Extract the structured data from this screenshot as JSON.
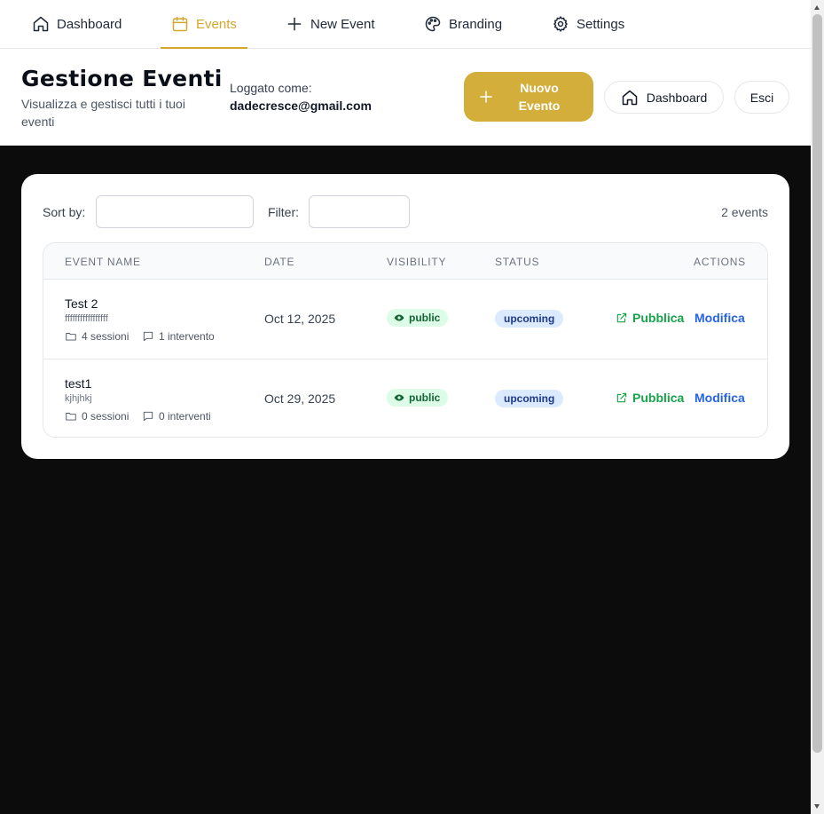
{
  "nav": {
    "items": [
      {
        "label": "Dashboard",
        "icon": "home-icon"
      },
      {
        "label": "Events",
        "icon": "calendar-icon",
        "active": true
      },
      {
        "label": "New Event",
        "icon": "plus-icon"
      },
      {
        "label": "Branding",
        "icon": "palette-icon"
      },
      {
        "label": "Settings",
        "icon": "gear-icon"
      }
    ]
  },
  "header": {
    "title": "Gestione Eventi",
    "subtitle": "Visualizza e gestisci tutti i tuoi eventi",
    "login_label": "Loggato come:",
    "login_email": "dadecresce@gmail.com",
    "new_button": "Nuovo Evento",
    "dashboard_button": "Dashboard",
    "logout_button": "Esci"
  },
  "toolbar": {
    "sort_label": "Sort by:",
    "sort_value": "",
    "filter_label": "Filter:",
    "filter_value": "",
    "count": "2 events"
  },
  "table": {
    "columns": [
      "EVENT NAME",
      "DATE",
      "VISIBILITY",
      "STATUS",
      "ACTIONS"
    ],
    "rows": [
      {
        "name": "Test 2",
        "description": "fffffffffffffffff",
        "sessions": "4 sessioni",
        "talks": "1 intervento",
        "date": "Oct 12, 2025",
        "visibility": "public",
        "status": "upcoming",
        "publish": "Pubblica",
        "edit": "Modifica"
      },
      {
        "name": "test1",
        "description": "kjhjhkj",
        "sessions": "0 sessioni",
        "talks": "0 interventi",
        "date": "Oct 29, 2025",
        "visibility": "public",
        "status": "upcoming",
        "publish": "Pubblica",
        "edit": "Modifica"
      }
    ]
  },
  "colors": {
    "accent": "#d4ae3a",
    "page_background": "#0c0c0c",
    "publish": "#16a34a",
    "edit": "#2563eb"
  }
}
